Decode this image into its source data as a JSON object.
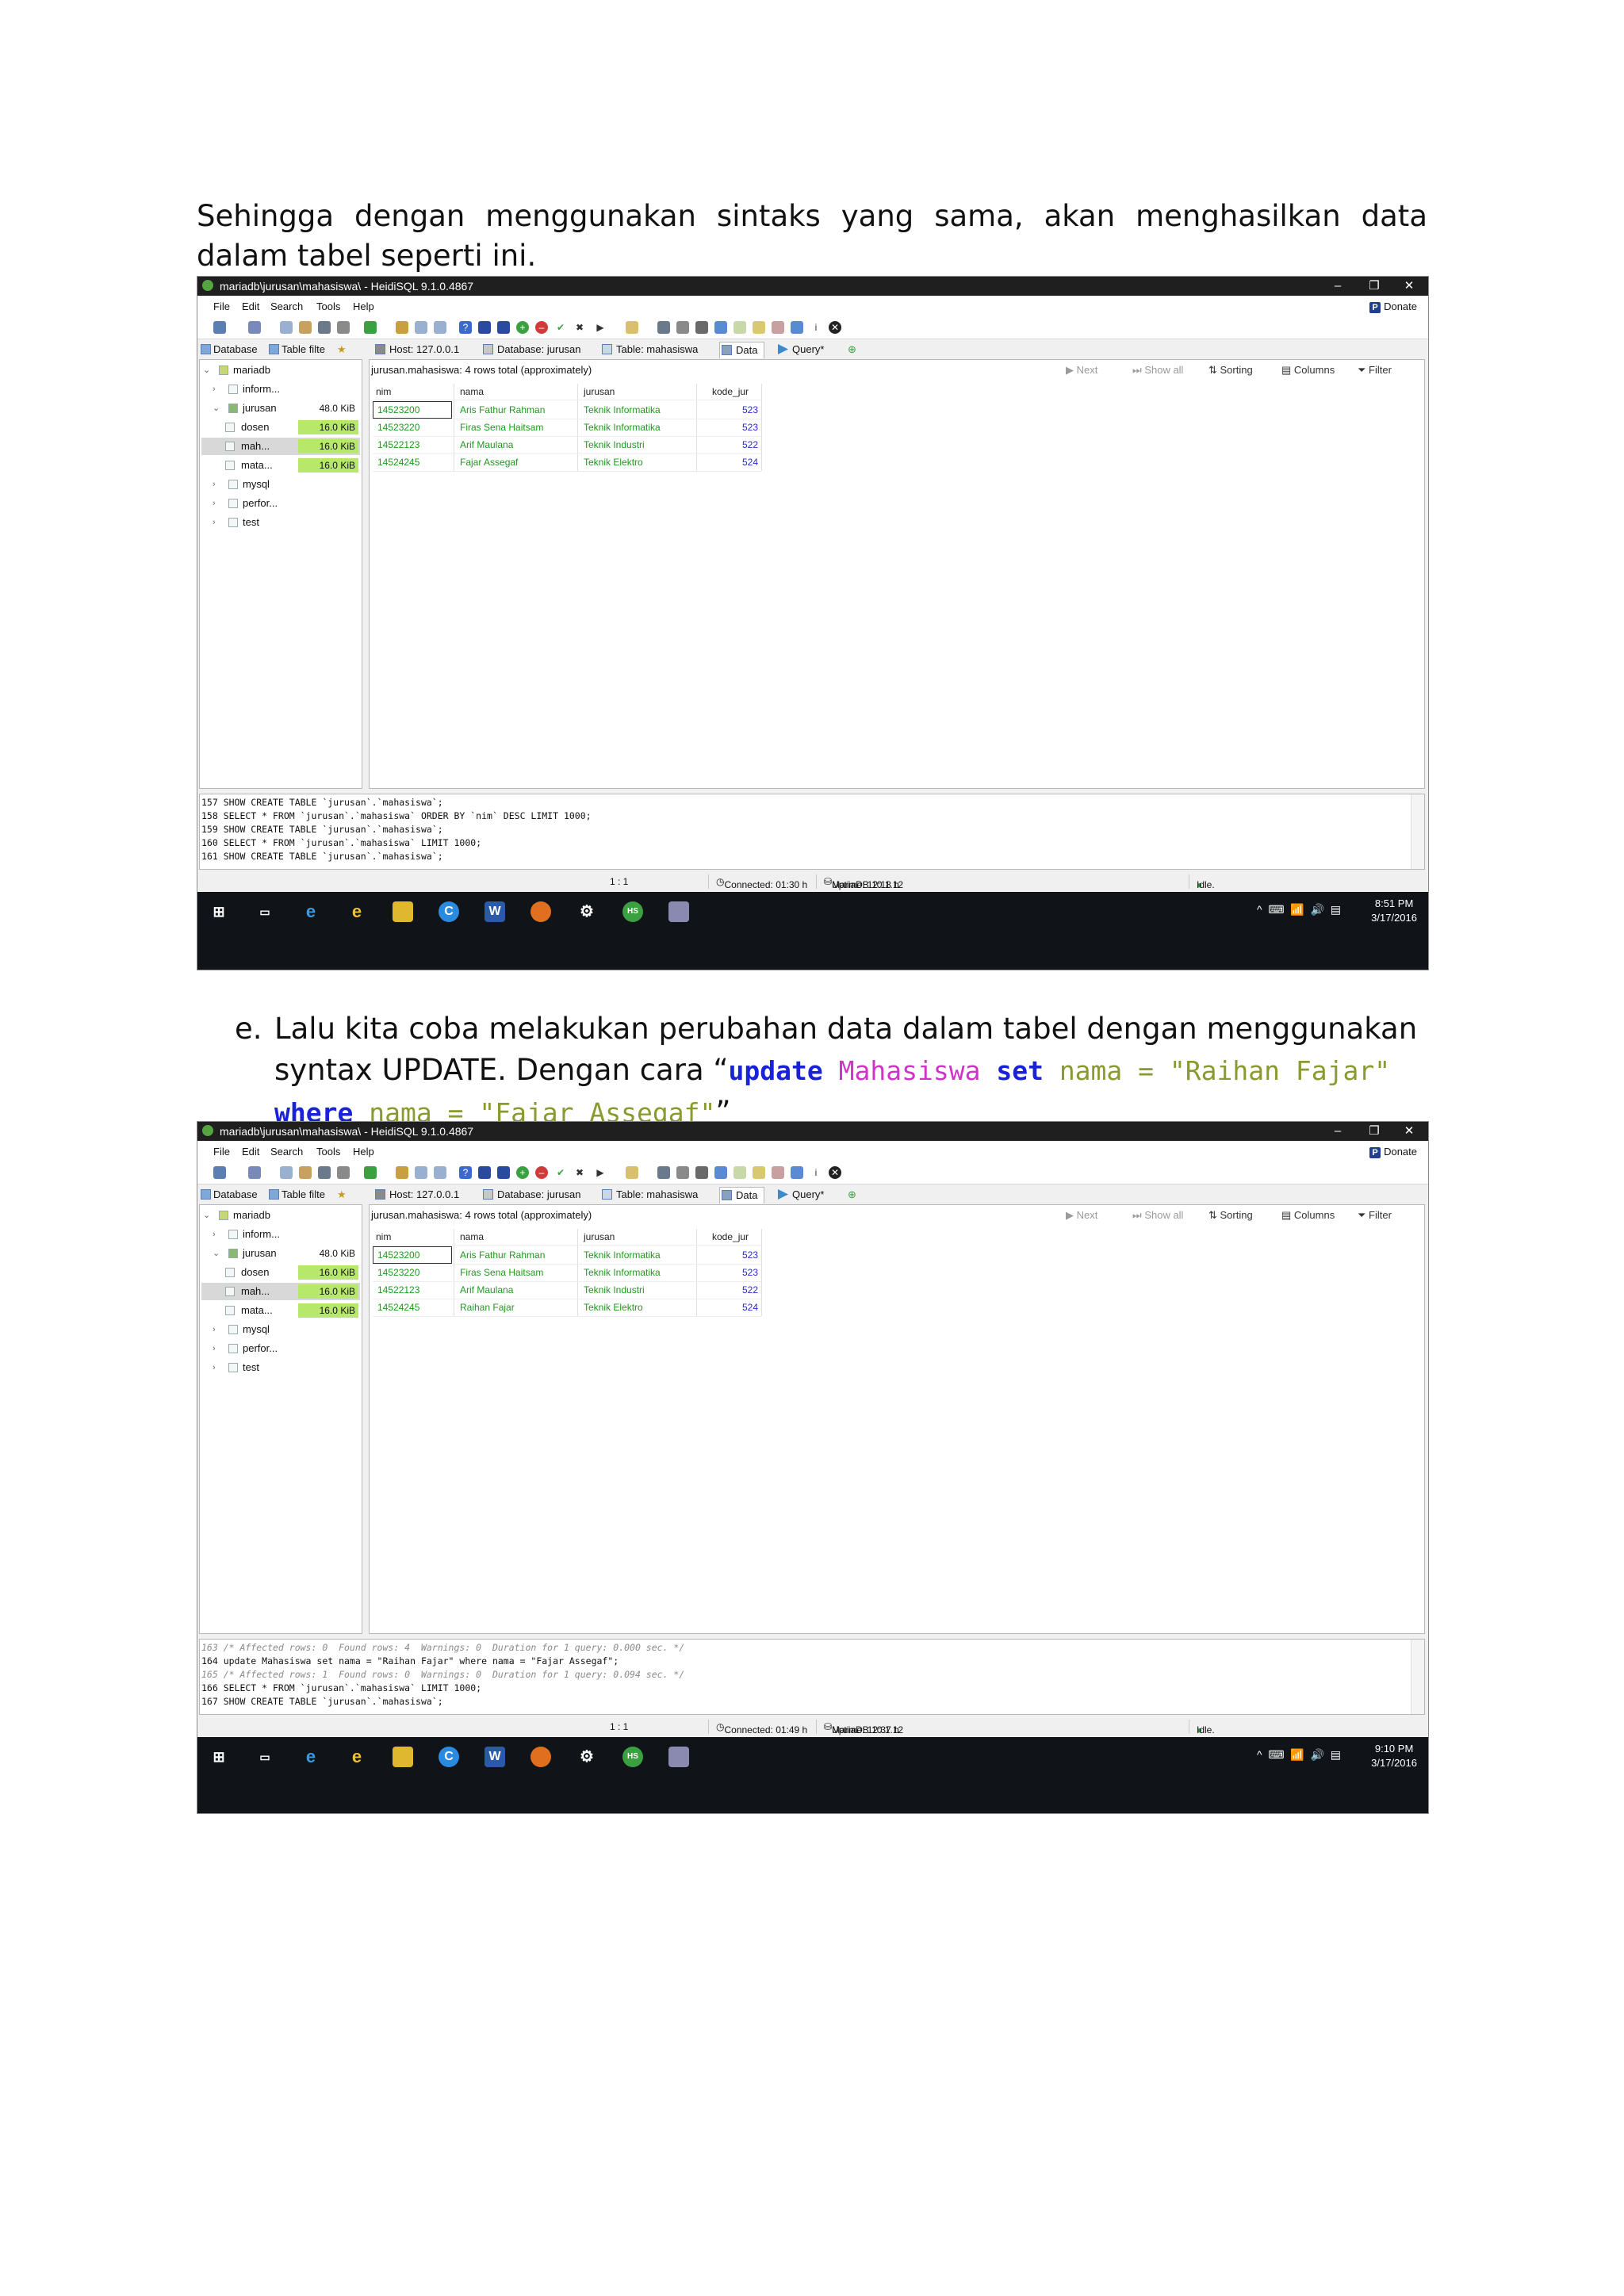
{
  "paragraph1": "Sehingga dengan menggunakan sintaks yang sama, akan menghasilkan data dalam tabel seperti ini.",
  "paragraph2": {
    "marker": "e.",
    "text": "Lalu kita coba melakukan perubahan data dalam tabel dengan menggunakan syntax UPDATE. Dengan cara “",
    "code": {
      "kw_update": "update",
      "table": "Mahasiswa",
      "kw_set": "set",
      "col1": "nama",
      "eq1": "=",
      "val1": "\"Raihan Fajar\"",
      "kw_where": "where",
      "col2": "nama",
      "eq2": "=",
      "val2": "\"Fajar Assegaf\""
    },
    "close": "”"
  },
  "app": {
    "menu": [
      "File",
      "Edit",
      "Search",
      "Tools",
      "Help"
    ],
    "donate": "Donate",
    "tabs": {
      "database": "Database",
      "table_filter": "Table filte",
      "host": "Host: 127.0.0.1",
      "db": "Database: jurusan",
      "table": "Table: mahasiswa",
      "data": "Data",
      "query": "Query*"
    },
    "grid_toolbar": {
      "next": "Next",
      "show_all": "Show all",
      "sorting": "Sorting",
      "columns": "Columns",
      "filter": "Filter"
    },
    "grid_title": "jurusan.mahasiswa: 4 rows total (approximately)",
    "columns": [
      "nim",
      "nama",
      "jurusan",
      "kode_jur"
    ],
    "tree": {
      "root": "mariadb",
      "inform": "inform...",
      "jurusan": "jurusan",
      "jurusan_size": "48.0 KiB",
      "dosen": "dosen",
      "dosen_size": "16.0 KiB",
      "mah": "mah...",
      "mah_size": "16.0 KiB",
      "mata": "mata...",
      "mata_size": "16.0 KiB",
      "mysql": "mysql",
      "perfor": "perfor...",
      "test": "test"
    },
    "status": {
      "pos": "1 : 1",
      "server": "MariaDB 10.1.12",
      "idle": "Idle."
    }
  },
  "screenshot1": {
    "title": "mariadb\\jurusan\\mahasiswa\\ - HeidiSQL 9.1.0.4867",
    "rows": [
      [
        "14523200",
        "Aris Fathur Rahman",
        "Teknik Informatika",
        "523"
      ],
      [
        "14523220",
        "Firas Sena Haitsam",
        "Teknik Informatika",
        "523"
      ],
      [
        "14522123",
        "Arif Maulana",
        "Teknik Industri",
        "522"
      ],
      [
        "14524245",
        "Fajar Assegaf",
        "Teknik Elektro",
        "524"
      ]
    ],
    "log": [
      "157 SHOW CREATE TABLE `jurusan`.`mahasiswa`;",
      "158 SELECT * FROM `jurusan`.`mahasiswa` ORDER BY `nim` DESC LIMIT 1000;",
      "159 SHOW CREATE TABLE `jurusan`.`mahasiswa`;",
      "160 SELECT * FROM `jurusan`.`mahasiswa` LIMIT 1000;",
      "161 SHOW CREATE TABLE `jurusan`.`mahasiswa`;"
    ],
    "connected": "Connected: 01:30 h",
    "uptime": "Uptime: 12:18 h",
    "clock_time": "8:51 PM",
    "clock_date": "3/17/2016"
  },
  "screenshot2": {
    "title": "mariadb\\jurusan\\mahasiswa\\ - HeidiSQL 9.1.0.4867",
    "rows": [
      [
        "14523200",
        "Aris Fathur Rahman",
        "Teknik Informatika",
        "523"
      ],
      [
        "14523220",
        "Firas Sena Haitsam",
        "Teknik Informatika",
        "523"
      ],
      [
        "14522123",
        "Arif Maulana",
        "Teknik Industri",
        "522"
      ],
      [
        "14524245",
        "Raihan Fajar",
        "Teknik Elektro",
        "524"
      ]
    ],
    "log": [
      "163 /* Affected rows: 0  Found rows: 4  Warnings: 0  Duration for 1 query: 0.000 sec. */",
      "164 update Mahasiswa set nama = \"Raihan Fajar\" where nama = \"Fajar Assegaf\";",
      "165 /* Affected rows: 1  Found rows: 0  Warnings: 0  Duration for 1 query: 0.094 sec. */",
      "166 SELECT * FROM `jurusan`.`mahasiswa` LIMIT 1000;",
      "167 SHOW CREATE TABLE `jurusan`.`mahasiswa`;"
    ],
    "connected": "Connected: 01:49 h",
    "uptime": "Uptime: 12:37 h",
    "clock_time": "9:10 PM",
    "clock_date": "3/17/2016"
  }
}
